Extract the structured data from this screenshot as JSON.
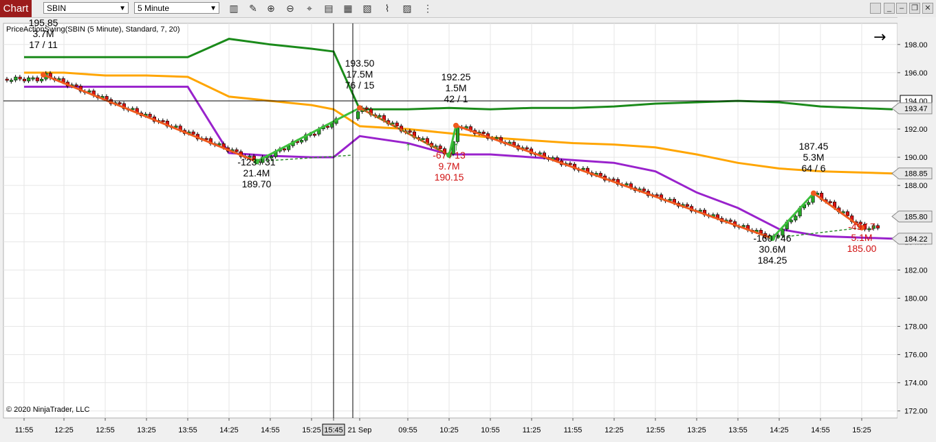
{
  "toolbar": {
    "tab_label": "Chart",
    "instrument": "SBIN",
    "interval": "5 Minute",
    "icons": [
      "bar-type-icon",
      "pencil-draw-icon",
      "zoom-in-icon",
      "zoom-out-icon",
      "crosshair-icon",
      "data-box-icon",
      "properties-icon",
      "indicators-icon",
      "strategies-icon",
      "templates-icon",
      "more-icon"
    ],
    "window_buttons": [
      "minimize",
      "restore",
      "maximize",
      "close"
    ]
  },
  "indicator_label": "PriceActionSwing(SBIN (5 Minute), Standard, 7, 20)",
  "copyright": "© 2020 NinjaTrader, LLC",
  "colors": {
    "up_candle": "#26a626",
    "down_candle": "#dd1111",
    "upper_band": "#1a8a1a",
    "mid_band": "#ffa500",
    "lower_band": "#9922cc",
    "swing_up": "#3cbf3c",
    "swing_down": "#f05a1e",
    "label_red": "#d01010"
  },
  "price_axis": {
    "ticks": [
      "198.00",
      "196.00",
      "194.00",
      "192.00",
      "190.00",
      "188.00",
      "186.00",
      "184.00",
      "182.00",
      "180.00",
      "178.00",
      "176.00",
      "174.00",
      "172.00"
    ],
    "current_price": "194.00",
    "markers": [
      {
        "value": "193.47",
        "fill": "#e8e8e8",
        "text": "#000"
      },
      {
        "value": "188.85",
        "fill": "#e8e8e8",
        "text": "#000"
      },
      {
        "value": "185.80",
        "fill": "#e8e8e8",
        "text": "#000"
      },
      {
        "value": "184.22",
        "fill": "#e8e8e8",
        "text": "#000"
      }
    ]
  },
  "time_axis": {
    "ticks": [
      "11:55",
      "12:25",
      "12:55",
      "13:25",
      "13:55",
      "14:25",
      "14:55",
      "15:25",
      "15:45",
      "21 Sep",
      "09:55",
      "10:25",
      "10:55",
      "11:25",
      "11:55",
      "12:25",
      "12:55",
      "13:25",
      "13:55",
      "14:25",
      "14:55",
      "15:25"
    ],
    "cursor_label": "15:45"
  },
  "swing_labels": [
    {
      "lines": [
        "195.85",
        "3.7M",
        "17 / 11"
      ],
      "color": "black"
    },
    {
      "lines": [
        "193.50",
        "17.5M",
        "76 / 15"
      ],
      "color": "black"
    },
    {
      "lines": [
        "192.25",
        "1.5M",
        "42 / 1"
      ],
      "color": "black"
    },
    {
      "lines": [
        "187.45",
        "5.3M",
        "64 / 6"
      ],
      "color": "black"
    },
    {
      "lines": [
        "-123 / 31",
        "21.4M",
        "189.70"
      ],
      "color": "black"
    },
    {
      "lines": [
        "-67 / 13",
        "9.7M",
        "190.15"
      ],
      "color": "red"
    },
    {
      "lines": [
        "-160 / 46",
        "30.6M",
        "184.25"
      ],
      "color": "black"
    },
    {
      "lines": [
        "-49 / 7",
        "5.1M",
        "185.00"
      ],
      "color": "red"
    }
  ],
  "chart_data": {
    "type": "candlestick",
    "instrument": "SBIN",
    "interval": "5 Minute",
    "ylim": [
      171.5,
      199.5
    ],
    "x": [
      "11:55",
      "12:25",
      "12:55",
      "13:25",
      "13:55",
      "14:25",
      "14:55",
      "15:25",
      "15:45",
      "21 Sep",
      "09:55",
      "10:25",
      "10:55",
      "11:25",
      "11:55",
      "12:25",
      "12:55",
      "13:25",
      "13:55",
      "14:25",
      "14:55",
      "15:25"
    ],
    "series": [
      {
        "name": "upper",
        "values": [
          197.1,
          197.1,
          197.1,
          197.1,
          197.1,
          198.4,
          198.0,
          197.7,
          197.5,
          193.4,
          193.4,
          193.5,
          193.4,
          193.5,
          193.5,
          193.6,
          193.8,
          193.9,
          194.0,
          193.9,
          193.6,
          193.4
        ]
      },
      {
        "name": "mid",
        "values": [
          196.0,
          196.0,
          195.8,
          195.8,
          195.7,
          194.3,
          194.0,
          193.7,
          193.4,
          192.2,
          192.0,
          191.7,
          191.4,
          191.2,
          191.0,
          190.9,
          190.7,
          190.2,
          189.6,
          189.2,
          189.0,
          188.85
        ]
      },
      {
        "name": "lower",
        "values": [
          195.0,
          195.0,
          195.0,
          195.0,
          195.0,
          190.3,
          190.1,
          190.0,
          190.0,
          191.5,
          191.0,
          190.2,
          190.2,
          190.0,
          189.8,
          189.6,
          189.0,
          187.5,
          186.4,
          184.9,
          184.4,
          184.22
        ]
      },
      {
        "name": "swing",
        "values": [
          195.85,
          189.7,
          193.5,
          190.15,
          192.25,
          184.25,
          187.45,
          185.0
        ]
      }
    ]
  }
}
